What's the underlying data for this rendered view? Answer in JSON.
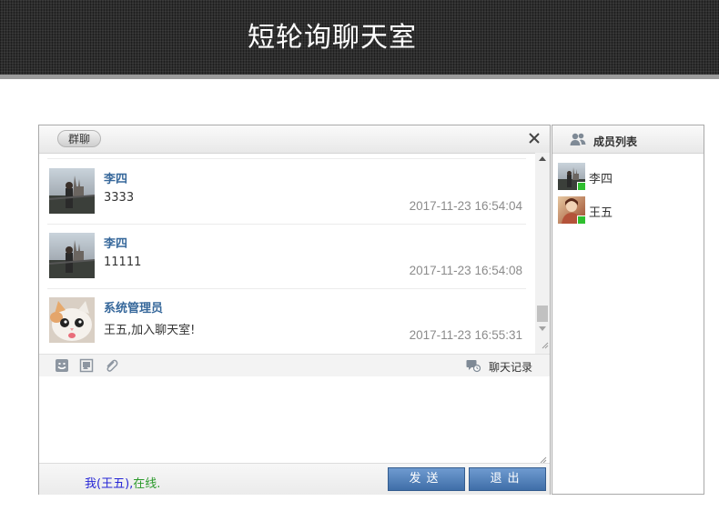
{
  "app": {
    "title": "短轮询聊天室"
  },
  "chat": {
    "tab_label": "群聊",
    "messages": [
      {
        "name": "李四",
        "text": "3333",
        "time": "2017-11-23 16:54:04",
        "avatar": "landscape-avatar"
      },
      {
        "name": "李四",
        "text": "11111",
        "time": "2017-11-23 16:54:08",
        "avatar": "landscape-avatar"
      },
      {
        "name": "系统管理员",
        "text": "王五,加入聊天室!",
        "time": "2017-11-23 16:55:31",
        "avatar": "cat-avatar"
      }
    ],
    "toolbar": {
      "history_label": "聊天记录",
      "icons": [
        "emoji-icon",
        "image-icon",
        "attachment-icon"
      ]
    },
    "input": {
      "value": ""
    },
    "status": {
      "me": "我(王五),",
      "online": "在线."
    },
    "buttons": {
      "send": "发送",
      "exit": "退出"
    }
  },
  "members": {
    "title": "成员列表",
    "items": [
      {
        "name": "李四",
        "avatar": "landscape-avatar",
        "status": "online"
      },
      {
        "name": "王五",
        "avatar": "portrait-avatar",
        "status": "online"
      }
    ]
  },
  "colors": {
    "header_bg": "#2e2e2e",
    "name_blue": "#37689b",
    "button_blue": "#4a78b0",
    "status_blue": "#2525d6",
    "online_green": "#2b9a2b",
    "online_dot": "#2fbf2f"
  }
}
